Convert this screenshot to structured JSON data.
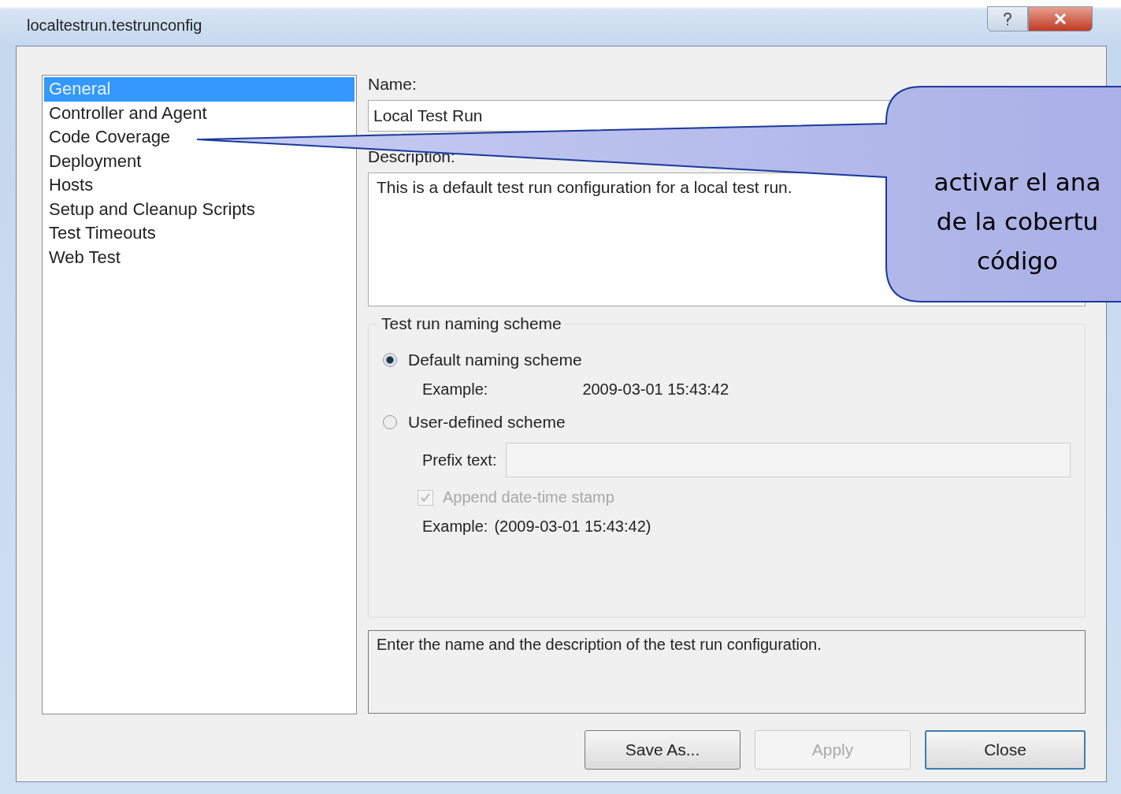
{
  "window": {
    "title": "localtestrun.testrunconfig"
  },
  "categories": [
    {
      "label": "General",
      "selected": true
    },
    {
      "label": "Controller and Agent",
      "selected": false
    },
    {
      "label": "Code Coverage",
      "selected": false
    },
    {
      "label": "Deployment",
      "selected": false
    },
    {
      "label": "Hosts",
      "selected": false
    },
    {
      "label": "Setup and Cleanup Scripts",
      "selected": false
    },
    {
      "label": "Test Timeouts",
      "selected": false
    },
    {
      "label": "Web Test",
      "selected": false
    }
  ],
  "name": {
    "label": "Name:",
    "value": "Local Test Run"
  },
  "description": {
    "label": "Description:",
    "value": "This is a default test run configuration for a local test run."
  },
  "naming_scheme": {
    "legend": "Test run naming scheme",
    "options": [
      {
        "label": "Default naming scheme",
        "selected": true
      },
      {
        "label": "User-defined scheme",
        "selected": false
      }
    ],
    "default_example": {
      "label": "Example:",
      "value": "2009-03-01 15:43:42"
    },
    "prefix_label": "Prefix text:",
    "append": {
      "label": "Append date-time stamp",
      "checked": true,
      "disabled": true
    },
    "user_example": {
      "label": "Example:",
      "value": "(2009-03-01 15:43:42)"
    }
  },
  "help_text": "Enter the name and the description of the test run configuration.",
  "buttons": [
    {
      "label": "Save As...",
      "disabled": false,
      "default": false
    },
    {
      "label": "Apply",
      "disabled": true,
      "default": false
    },
    {
      "label": "Close",
      "disabled": false,
      "default": true
    }
  ],
  "callout": {
    "lines": [
      "activar el ana",
      "de la cobertu",
      "código"
    ]
  }
}
